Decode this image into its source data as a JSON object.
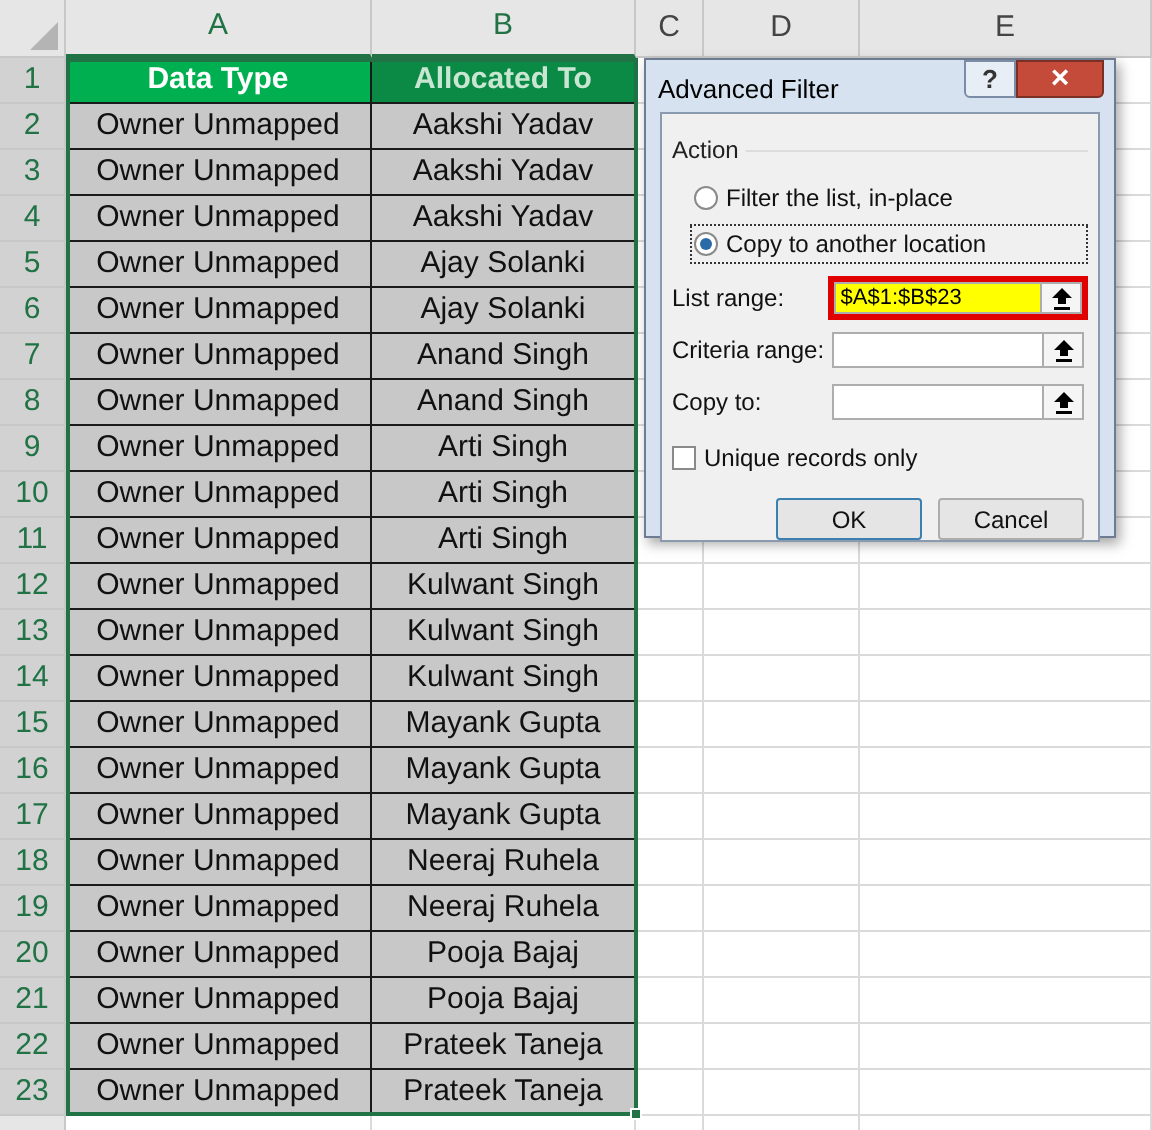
{
  "sheet": {
    "columns": [
      "A",
      "B",
      "C",
      "D",
      "E"
    ],
    "header": [
      "Data Type",
      "Allocated To"
    ],
    "rows": [
      [
        "Owner Unmapped",
        "Aakshi Yadav"
      ],
      [
        "Owner Unmapped",
        "Aakshi Yadav"
      ],
      [
        "Owner Unmapped",
        "Aakshi Yadav"
      ],
      [
        "Owner Unmapped",
        "Ajay Solanki"
      ],
      [
        "Owner Unmapped",
        "Ajay Solanki"
      ],
      [
        "Owner Unmapped",
        "Anand Singh"
      ],
      [
        "Owner Unmapped",
        "Anand Singh"
      ],
      [
        "Owner Unmapped",
        "Arti Singh"
      ],
      [
        "Owner Unmapped",
        "Arti Singh"
      ],
      [
        "Owner Unmapped",
        "Arti Singh"
      ],
      [
        "Owner Unmapped",
        "Kulwant Singh"
      ],
      [
        "Owner Unmapped",
        "Kulwant Singh"
      ],
      [
        "Owner Unmapped",
        "Kulwant Singh"
      ],
      [
        "Owner Unmapped",
        "Mayank Gupta"
      ],
      [
        "Owner Unmapped",
        "Mayank Gupta"
      ],
      [
        "Owner Unmapped",
        "Mayank Gupta"
      ],
      [
        "Owner Unmapped",
        "Neeraj Ruhela"
      ],
      [
        "Owner Unmapped",
        "Neeraj Ruhela"
      ],
      [
        "Owner Unmapped",
        "Pooja Bajaj"
      ],
      [
        "Owner Unmapped",
        "Pooja Bajaj"
      ],
      [
        "Owner Unmapped",
        "Prateek Taneja"
      ],
      [
        "Owner Unmapped",
        "Prateek Taneja"
      ]
    ],
    "row_numbers": [
      "1",
      "2",
      "3",
      "4",
      "5",
      "6",
      "7",
      "8",
      "9",
      "10",
      "11",
      "12",
      "13",
      "14",
      "15",
      "16",
      "17",
      "18",
      "19",
      "20",
      "21",
      "22",
      "23"
    ]
  },
  "dialog": {
    "title": "Advanced Filter",
    "help": "?",
    "close": "×",
    "group": "Action",
    "options": [
      {
        "label": "Filter the list, in-place",
        "selected": false
      },
      {
        "label": "Copy to another location",
        "selected": true
      }
    ],
    "fields": [
      {
        "label": "List range:",
        "value": "$A$1:$B$23",
        "highlighted": true
      },
      {
        "label": "Criteria range:",
        "highlighted": false
      },
      {
        "label": "Copy to:",
        "highlighted": false
      }
    ],
    "unique": {
      "label": "Unique records only",
      "checked": false
    },
    "buttons": [
      "OK",
      "Cancel"
    ]
  }
}
